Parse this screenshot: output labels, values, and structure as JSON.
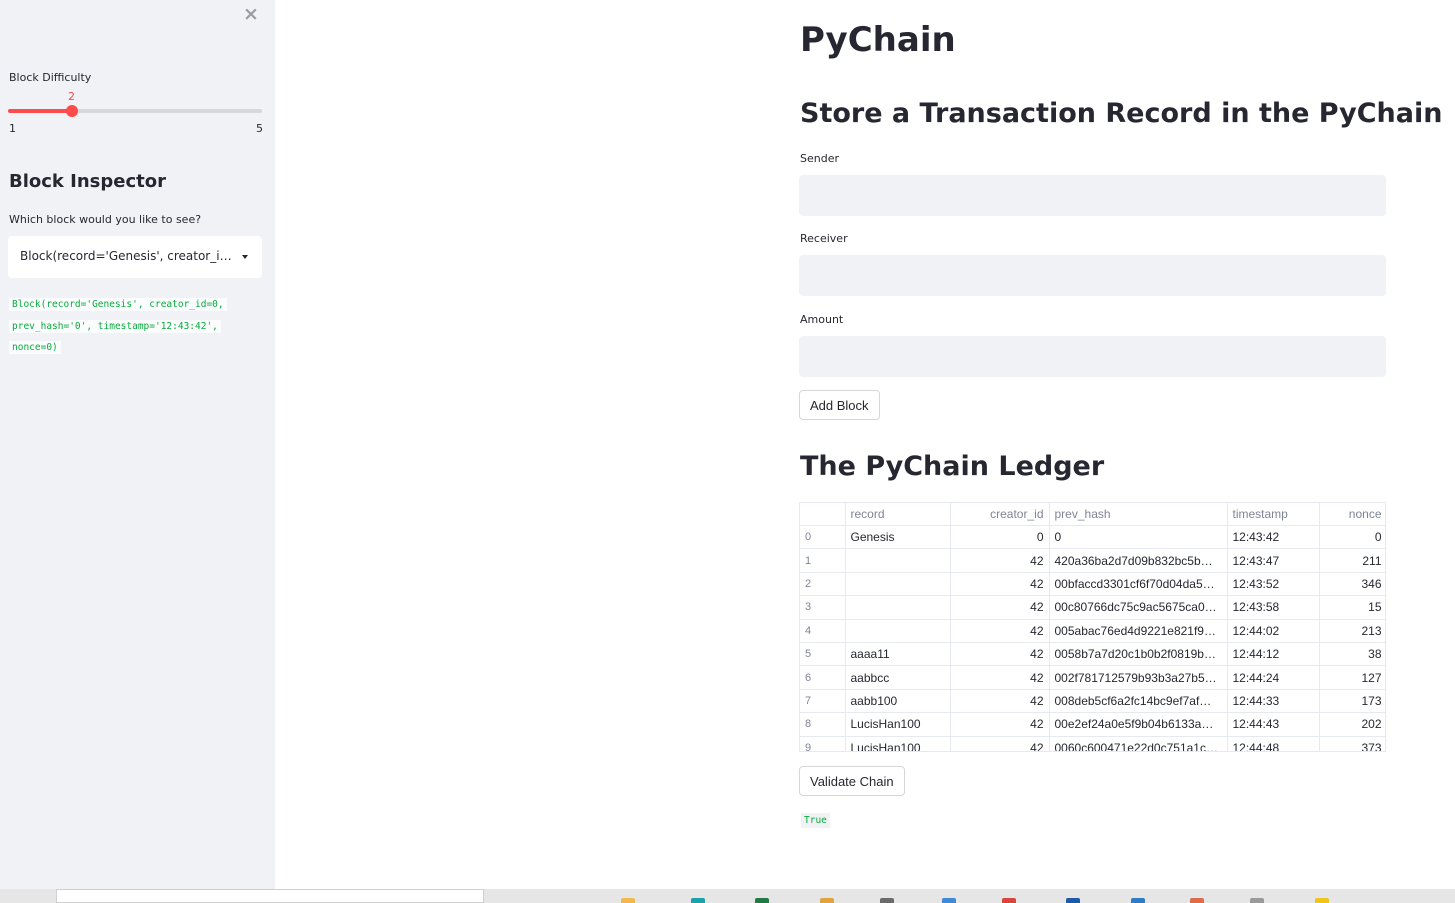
{
  "sidebar": {
    "close_icon": "×",
    "difficulty_label": "Block Difficulty",
    "slider": {
      "value": 2,
      "min": 1,
      "max": 5,
      "min_label": "1",
      "max_label": "5",
      "value_label": "2"
    },
    "inspector_title": "Block Inspector",
    "select_label": "Which block would you like to see?",
    "select_value": "Block(record='Genesis', creator_id=0, prev_hash='0', timestamp='12:43:42', nonce=0)",
    "block_output": [
      "Block(record='Genesis', creator_id=0,",
      "prev_hash='0', timestamp='12:43:42',",
      "nonce=0)"
    ]
  },
  "main": {
    "title": "PyChain",
    "form_title": "Store a Transaction Record in the PyChain",
    "sender_label": "Sender",
    "sender_value": "",
    "receiver_label": "Receiver",
    "receiver_value": "",
    "amount_label": "Amount",
    "amount_value": "",
    "add_block_button": "Add Block",
    "ledger_title": "The PyChain Ledger",
    "ledger": {
      "columns": [
        "",
        "record",
        "creator_id",
        "prev_hash",
        "timestamp",
        "nonce"
      ],
      "rows": [
        [
          "0",
          "Genesis",
          "0",
          "0",
          "12:43:42",
          "0"
        ],
        [
          "1",
          "",
          "42",
          "420a36ba2d7d09b832bc5b…",
          "12:43:47",
          "211"
        ],
        [
          "2",
          "",
          "42",
          "00bfaccd3301cf6f70d04da5…",
          "12:43:52",
          "346"
        ],
        [
          "3",
          "",
          "42",
          "00c80766dc75c9ac5675ca0…",
          "12:43:58",
          "15"
        ],
        [
          "4",
          "",
          "42",
          "005abac76ed4d9221e821f9…",
          "12:44:02",
          "213"
        ],
        [
          "5",
          "aaaa11",
          "42",
          "0058b7a7d20c1b0b2f0819b…",
          "12:44:12",
          "38"
        ],
        [
          "6",
          "aabbcc",
          "42",
          "002f781712579b93b3a27b5…",
          "12:44:24",
          "127"
        ],
        [
          "7",
          "aabb100",
          "42",
          "008deb5cf6a2fc14bc9ef7af…",
          "12:44:33",
          "173"
        ],
        [
          "8",
          "LucisHan100",
          "42",
          "00e2ef24a0e5f9b04b6133a…",
          "12:44:43",
          "202"
        ],
        [
          "9",
          "LucisHan100",
          "42",
          "0060c600471e22d0c751a1c…",
          "12:44:48",
          "373"
        ]
      ]
    },
    "validate_button": "Validate Chain",
    "validate_result": "True"
  },
  "colors": {
    "accent": "#ff4b4b",
    "sidebar_bg": "#f0f2f6",
    "code_green": "#09ab3b"
  },
  "taskbar": {
    "icons": [
      {
        "name": "app-icon-1",
        "color": "#f2b84b"
      },
      {
        "name": "app-icon-2",
        "color": "#1ba1a8"
      },
      {
        "name": "app-icon-3",
        "color": "#1f7a45"
      },
      {
        "name": "app-icon-4",
        "color": "#e2a23c"
      },
      {
        "name": "app-icon-5",
        "color": "#6b6b6b"
      },
      {
        "name": "app-icon-6",
        "color": "#3c8ad8"
      },
      {
        "name": "app-icon-7",
        "color": "#d9453a"
      },
      {
        "name": "app-icon-8",
        "color": "#1e5aa8"
      },
      {
        "name": "app-icon-9",
        "color": "#2f7bc4"
      },
      {
        "name": "app-icon-10",
        "color": "#e06b4a"
      },
      {
        "name": "app-icon-11",
        "color": "#9a9a9a"
      },
      {
        "name": "app-icon-12",
        "color": "#f0c419"
      }
    ]
  }
}
